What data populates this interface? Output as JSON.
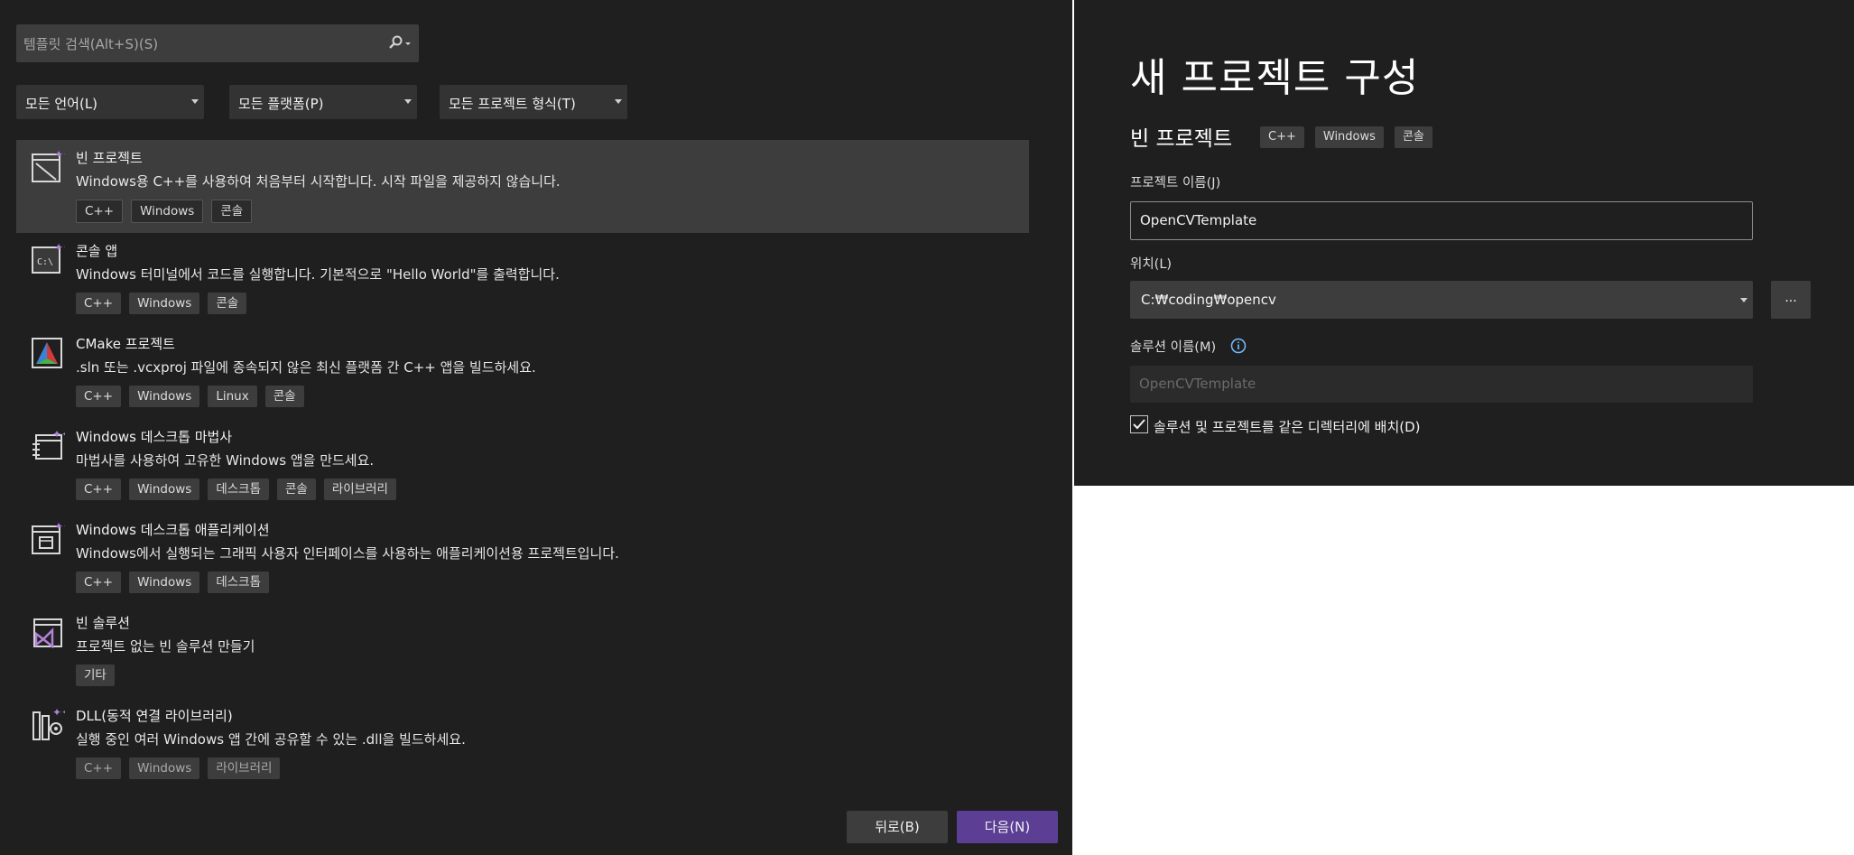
{
  "search": {
    "placeholder": "템플릿 검색(Alt+S)(S)"
  },
  "filters": {
    "language": "모든 언어(L)",
    "platform": "모든 플랫폼(P)",
    "project_type": "모든 프로젝트 형식(T)"
  },
  "templates": [
    {
      "title": "빈 프로젝트",
      "desc": "Windows용 C++를 사용하여 처음부터 시작합니다. 시작 파일을 제공하지 않습니다.",
      "tags": [
        "C++",
        "Windows",
        "콘솔"
      ],
      "icon": "empty-project-icon"
    },
    {
      "title": "콘솔 앱",
      "desc": "Windows 터미널에서 코드를 실행합니다. 기본적으로 \"Hello World\"를 출력합니다.",
      "tags": [
        "C++",
        "Windows",
        "콘솔"
      ],
      "icon": "console-app-icon"
    },
    {
      "title": "CMake 프로젝트",
      "desc": ".sln 또는 .vcxproj 파일에 종속되지 않은 최신 플랫폼 간 C++ 앱을 빌드하세요.",
      "tags": [
        "C++",
        "Windows",
        "Linux",
        "콘솔"
      ],
      "icon": "cmake-icon"
    },
    {
      "title": "Windows 데스크톱 마법사",
      "desc": "마법사를 사용하여 고유한 Windows 앱을 만드세요.",
      "tags": [
        "C++",
        "Windows",
        "데스크톱",
        "콘솔",
        "라이브러리"
      ],
      "icon": "desktop-wizard-icon"
    },
    {
      "title": "Windows 데스크톱 애플리케이션",
      "desc": "Windows에서 실행되는 그래픽 사용자 인터페이스를 사용하는 애플리케이션용 프로젝트입니다.",
      "tags": [
        "C++",
        "Windows",
        "데스크톱"
      ],
      "icon": "desktop-app-icon"
    },
    {
      "title": "빈 솔루션",
      "desc": "프로젝트 없는 빈 솔루션 만들기",
      "tags": [
        "기타"
      ],
      "icon": "empty-solution-icon"
    },
    {
      "title": "DLL(동적 연결 라이브러리)",
      "desc": "실행 중인 여러 Windows 앱 간에 공유할 수 있는 .dll을 빌드하세요.",
      "tags": [
        "C++",
        "Windows",
        "라이브러리"
      ],
      "icon": "dll-icon"
    }
  ],
  "buttons": {
    "back": "뒤로(B)",
    "next": "다음(N)"
  },
  "config": {
    "title": "새 프로젝트 구성",
    "template_name": "빈 프로젝트",
    "template_tags": [
      "C++",
      "Windows",
      "콘솔"
    ],
    "project_name_label": "프로젝트 이름(J)",
    "project_name_value": "OpenCVTemplate",
    "location_label": "위치(L)",
    "location_value": "C:₩coding₩opencv",
    "browse_label": "...",
    "solution_name_label": "솔루션 이름(M)",
    "solution_name_value": "OpenCVTemplate",
    "same_dir_label": "솔루션 및 프로젝트를 같은 디렉터리에 배치(D)",
    "same_dir_checked": true
  },
  "colors": {
    "background": "#1f1f1f",
    "accent_button": "#5c3e95",
    "field": "#3d3d3d",
    "icon_accent": "#b180d7"
  }
}
